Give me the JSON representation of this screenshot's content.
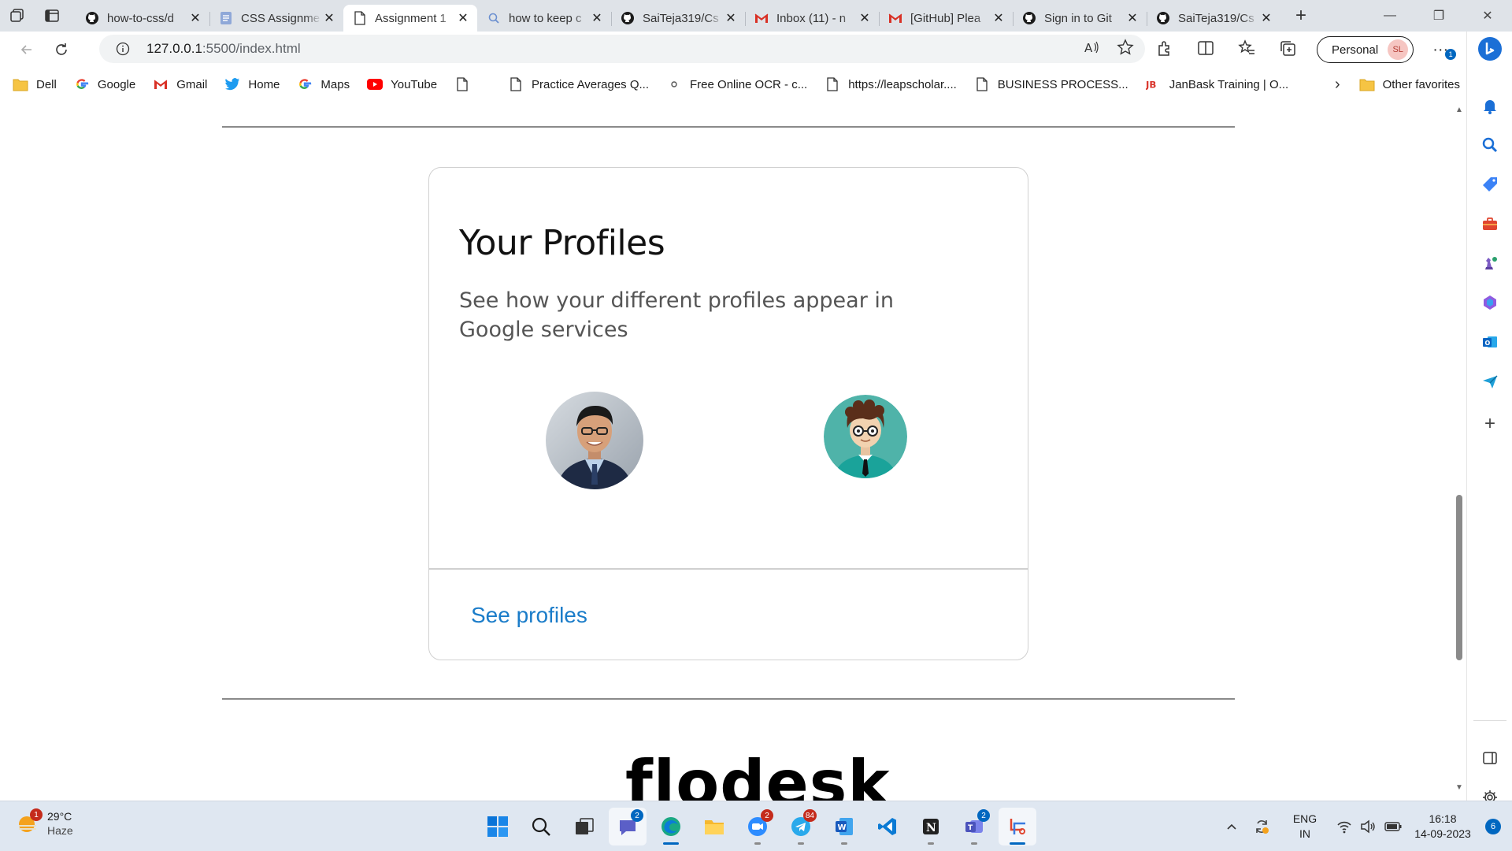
{
  "tabs": [
    {
      "title": "how-to-css/d",
      "icon": "github-icon"
    },
    {
      "title": "CSS Assignme",
      "icon": "docs-icon"
    },
    {
      "title": "Assignment 1",
      "icon": "page-icon",
      "active": true
    },
    {
      "title": "how to keep c",
      "icon": "search-icon"
    },
    {
      "title": "SaiTeja319/Cs",
      "icon": "github-icon"
    },
    {
      "title": "Inbox (11) - n",
      "icon": "gmail-icon"
    },
    {
      "title": "[GitHub] Plea",
      "icon": "gmail-icon"
    },
    {
      "title": "Sign in to Git",
      "icon": "github-icon"
    },
    {
      "title": "SaiTeja319/Cs",
      "icon": "github-icon"
    }
  ],
  "address": {
    "host": "127.0.0.1",
    "rest": ":5500/index.html"
  },
  "profile": {
    "label": "Personal",
    "initials": "SL"
  },
  "bookmarks": [
    {
      "label": "Dell",
      "icon": "folder-icon"
    },
    {
      "label": "Google",
      "icon": "google-icon"
    },
    {
      "label": "Gmail",
      "icon": "gmail-icon"
    },
    {
      "label": "Home",
      "icon": "twitter-icon"
    },
    {
      "label": "Maps",
      "icon": "google-icon"
    },
    {
      "label": "YouTube",
      "icon": "youtube-icon"
    },
    {
      "label": "",
      "icon": "page-icon"
    },
    {
      "label": "Practice Averages Q...",
      "icon": "page-icon"
    },
    {
      "label": "Free Online OCR - c...",
      "icon": "dot-icon"
    },
    {
      "label": "https://leapscholar....",
      "icon": "page-icon"
    },
    {
      "label": "BUSINESS PROCESS...",
      "icon": "page-icon"
    },
    {
      "label": "JanBask Training | O...",
      "icon": "jb-icon"
    }
  ],
  "bookmarks_other": "Other favorites",
  "card": {
    "title": "Your Profiles",
    "description": "See how your different profiles appear in Google services",
    "link": "See profiles"
  },
  "brand": "flodesk",
  "taskbar": {
    "weather_temp": "29°C",
    "weather_desc": "Haze",
    "weather_badge": "1",
    "lang": "ENG",
    "region": "IN",
    "time": "16:18",
    "date": "14-09-2023",
    "notifications": "6",
    "badges": {
      "chat": "2",
      "zoom": "2",
      "telegram": "84",
      "teams": "2"
    }
  },
  "sidebar_badge": "1"
}
